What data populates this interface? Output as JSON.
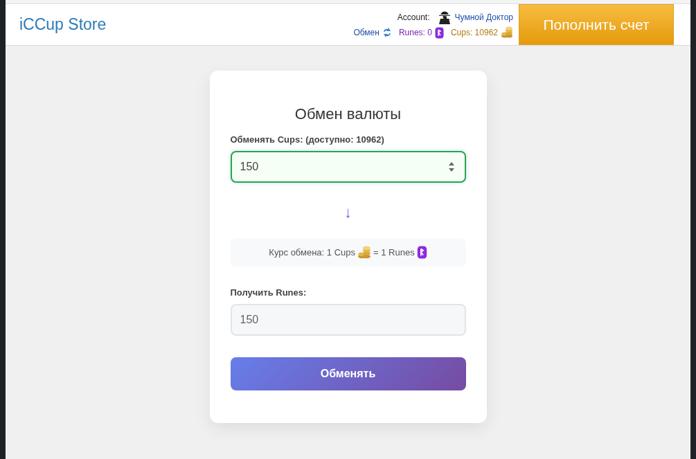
{
  "header": {
    "logo": "iCCup Store",
    "account_label": "Account:",
    "username": "Чумной Доктор",
    "exchange_link": "Обмен",
    "runes": "Runes: 0",
    "cups": "Cups: 10962",
    "top_up_button": "Пополнить счет"
  },
  "card": {
    "title": "Обмен валюты",
    "from_label": "Обменять Cups: (доступно: 10962)",
    "from_value": "150",
    "from_focused": true,
    "arrow": "↓",
    "rate": {
      "from_text": "Курс обмена: 1 Cups",
      "to_text": "= 1 Runes"
    },
    "to_label": "Получить Runes:",
    "to_value": "150",
    "to_readonly": true,
    "submit_button": "Обменять"
  }
}
